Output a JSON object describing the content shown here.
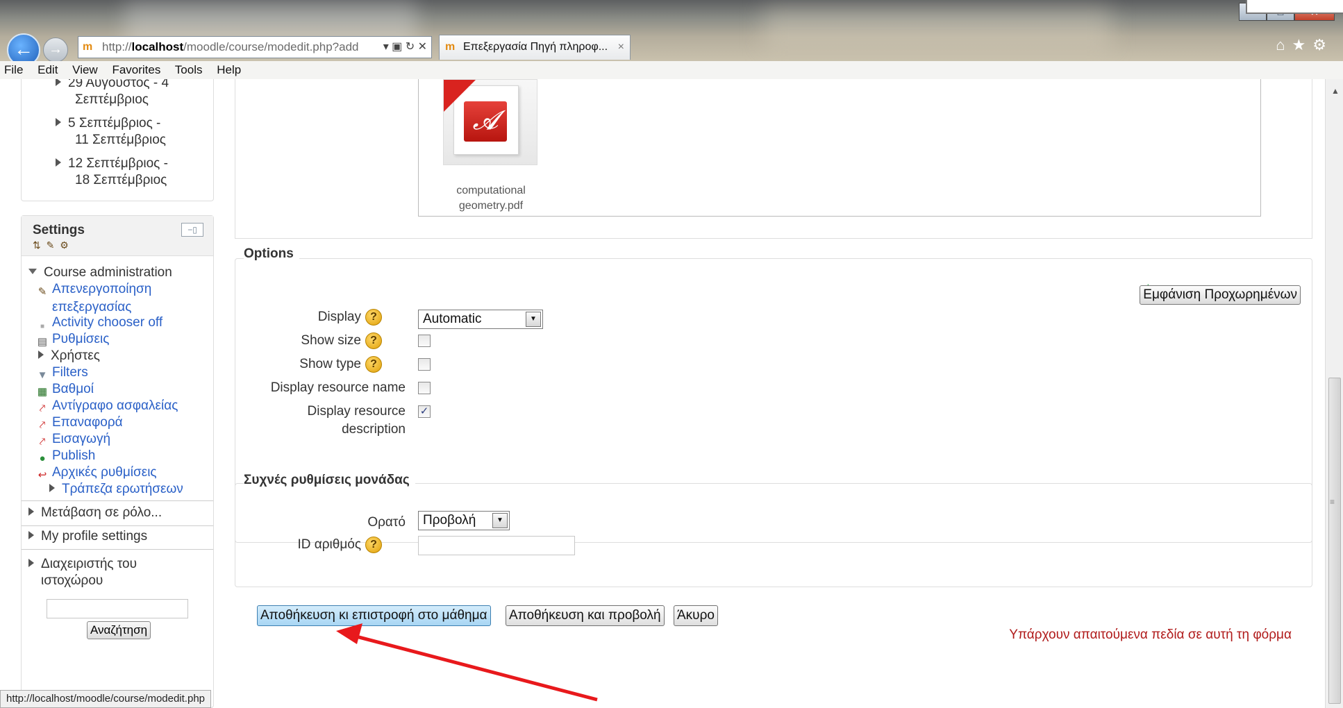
{
  "browser": {
    "url_prefix": "http://",
    "url_host": "localhost",
    "url_path": "/moodle/course/modedit.php?add",
    "tab_title": "Επεξεργασία Πηγή πληροφ...",
    "menu": [
      "File",
      "Edit",
      "View",
      "Favorites",
      "Tools",
      "Help"
    ],
    "status_url": "http://localhost/moodle/course/modedit.php"
  },
  "nav_block": {
    "weeks": [
      {
        "line1": "29 Αυγουστος - 4",
        "line2": "Σεπτέμβριος"
      },
      {
        "line1": "5 Σεπτέμβριος -",
        "line2": "11 Σεπτέμβριος"
      },
      {
        "line1": "12 Σεπτέμβριος -",
        "line2": "18 Σεπτέμβριος"
      }
    ]
  },
  "settings": {
    "title": "Settings",
    "course_admin": "Course administration",
    "items": {
      "disable_edit_1": "Απενεργοποίηση",
      "disable_edit_2": "επεξεργασίας",
      "activity_chooser": "Activity chooser off",
      "settings": "Ρυθμίσεις",
      "users": "Χρήστες",
      "filters": "Filters",
      "grades": "Βαθμοί",
      "backup": "Αντίγραφο ασφαλείας",
      "restore": "Επαναφορά",
      "import": "Εισαγωγή",
      "publish": "Publish",
      "reset": "Αρχικές ρυθμίσεις",
      "question_bank": "Τράπεζα ερωτήσεων"
    },
    "switch_role": "Μετάβαση σε ρόλο...",
    "profile": "My profile settings",
    "site_admin_1": "Διαχειριστής του",
    "site_admin_2": "ιστοχώρου",
    "search_button": "Αναζήτηση"
  },
  "file": {
    "name_line1": "computational",
    "name_line2": "geometry.pdf"
  },
  "options": {
    "legend": "Options",
    "advanced_button": "Εμφάνιση Προχωρημένων",
    "required_marker": "*",
    "display_label": "Display",
    "display_value": "Automatic",
    "show_size_label": "Show size",
    "show_type_label": "Show type",
    "display_name_label": "Display resource name",
    "display_desc_line1": "Display resource",
    "display_desc_line2": "description",
    "help_glyph": "?"
  },
  "common": {
    "legend": "Συχνές ρυθμίσεις μονάδας",
    "visible_label": "Ορατό",
    "visible_value": "Προβολή",
    "id_label": "ID αριθμός"
  },
  "actions": {
    "save_return": "Αποθήκευση κι επιστροφή στο μάθημα",
    "save_display": "Αποθήκευση και προβολή",
    "cancel": "Άκυρο",
    "required_note": "Υπάρχουν απαιτούμενα πεδία σε αυτή τη φόρμα"
  },
  "colors": {
    "link": "#2a60c7",
    "required_text": "#b01a1a",
    "annotation_arrow": "#e8191c"
  }
}
